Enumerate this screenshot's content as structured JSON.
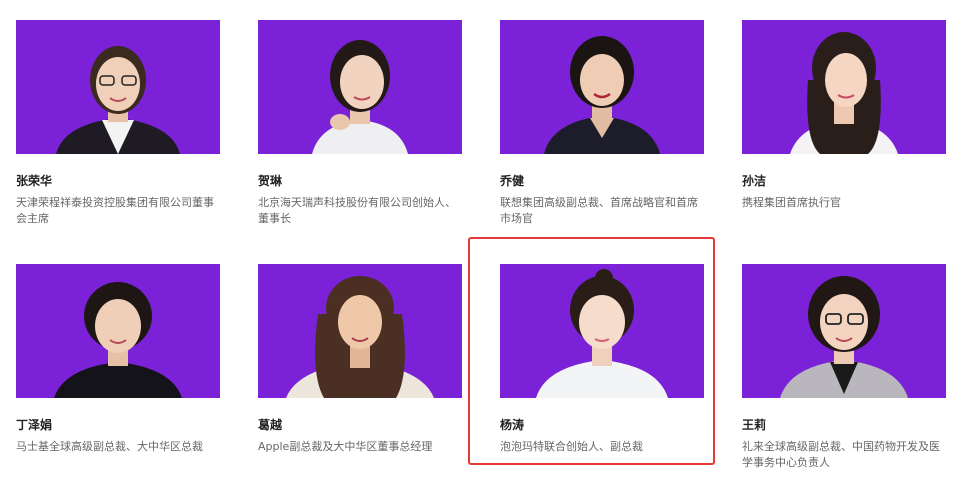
{
  "profiles": [
    {
      "name": "张荣华",
      "title": "天津荣程祥泰投资控股集团有限公司董事会主席",
      "photo_icon": "woman-portrait-glasses-icon"
    },
    {
      "name": "贺琳",
      "title": "北京海天瑞声科技股份有限公司创始人、董事长",
      "photo_icon": "woman-portrait-icon"
    },
    {
      "name": "乔健",
      "title": "联想集团高级副总裁、首席战略官和首席市场官",
      "photo_icon": "woman-portrait-icon"
    },
    {
      "name": "孙洁",
      "title": "携程集团首席执行官",
      "photo_icon": "woman-portrait-icon"
    },
    {
      "name": "丁泽娟",
      "title": "马士基全球高级副总裁、大中华区总裁",
      "photo_icon": "woman-portrait-icon"
    },
    {
      "name": "葛越",
      "title": "Apple副总裁及大中华区董事总经理",
      "photo_icon": "woman-portrait-icon"
    },
    {
      "name": "杨涛",
      "title": "泡泡玛特联合创始人、副总裁",
      "photo_icon": "woman-portrait-icon"
    },
    {
      "name": "王莉",
      "title": "礼来全球高级副总裁、中国药物开发及医学事务中心负责人",
      "photo_icon": "woman-portrait-glasses-icon"
    }
  ],
  "colors": {
    "photo_bg": "#7b22d9",
    "highlight": "#e53935"
  }
}
